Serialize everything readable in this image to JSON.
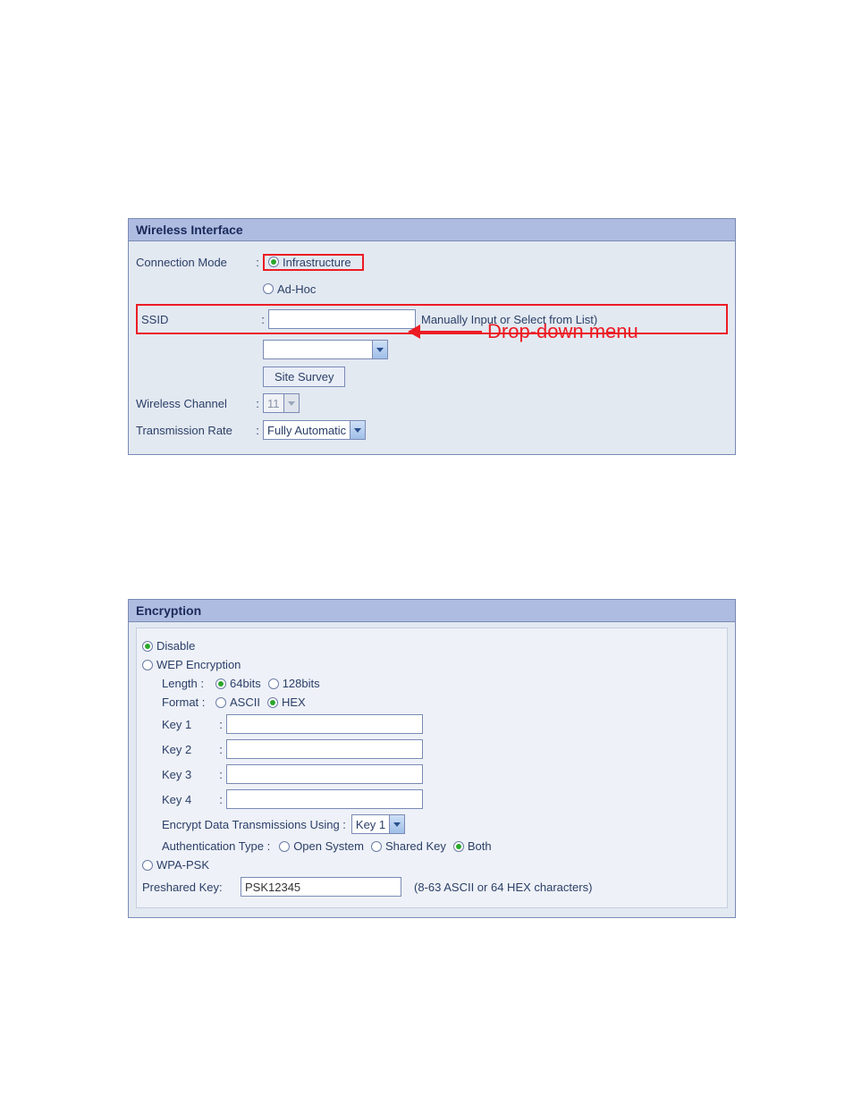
{
  "wireless": {
    "title": "Wireless Interface",
    "connection_mode_label": "Connection Mode",
    "infrastructure_label": "Infrastructure",
    "adhoc_label": "Ad-Hoc",
    "ssid_label": "SSID",
    "ssid_value": "",
    "ssid_hint": "Manually Input or Select from List)",
    "dropdown_selected": "",
    "site_survey_label": "Site Survey",
    "channel_label": "Wireless Channel",
    "channel_value": "11",
    "rate_label": "Transmission Rate",
    "rate_value": "Fully Automatic"
  },
  "annotation": {
    "dropdown_menu": "Drop-down menu"
  },
  "encryption": {
    "title": "Encryption",
    "disable_label": "Disable",
    "wep_label": "WEP Encryption",
    "length_label": "Length :",
    "length_64": "64bits",
    "length_128": "128bits",
    "format_label": "Format :",
    "format_ascii": "ASCII",
    "format_hex": "HEX",
    "key1_label": "Key 1",
    "key2_label": "Key 2",
    "key3_label": "Key 3",
    "key4_label": "Key 4",
    "encrypt_using_label": "Encrypt Data Transmissions Using  :",
    "encrypt_using_value": "Key 1",
    "auth_type_label": "Authentication Type  :",
    "auth_open": "Open System",
    "auth_shared": "Shared Key",
    "auth_both": "Both",
    "wpa_label": "WPA-PSK",
    "psk_label": "Preshared Key:",
    "psk_value": "PSK12345",
    "psk_hint": "(8-63 ASCII or 64 HEX characters)"
  }
}
